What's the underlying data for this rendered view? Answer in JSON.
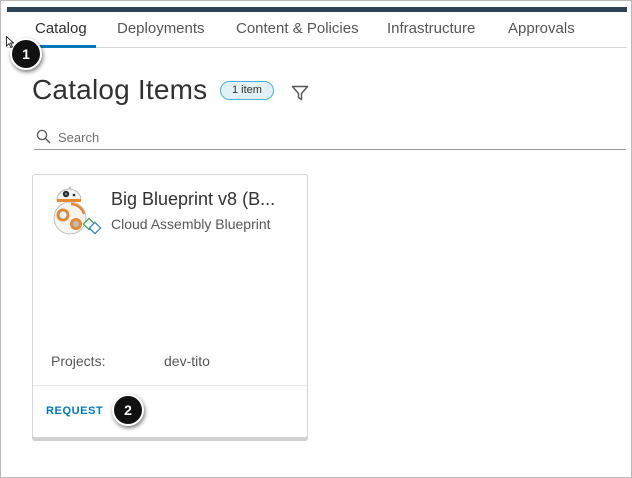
{
  "nav": {
    "tabs": [
      {
        "label": "Catalog",
        "active": true
      },
      {
        "label": "Deployments",
        "active": false
      },
      {
        "label": "Content & Policies",
        "active": false
      },
      {
        "label": "Infrastructure",
        "active": false
      },
      {
        "label": "Approvals",
        "active": false
      }
    ]
  },
  "page": {
    "title": "Catalog Items",
    "count_badge": "1 item",
    "filter_icon": "filter-icon"
  },
  "search": {
    "placeholder": "Search",
    "value": "",
    "icon": "search-icon"
  },
  "catalog_items": [
    {
      "icon": "bb8-robot-icon",
      "title": "Big Blueprint v8 (B...",
      "subtitle": "Cloud Assembly Blueprint",
      "projects_label": "Projects:",
      "projects_value": "dev-tito",
      "request_label": "REQUEST"
    }
  ],
  "markers": [
    "1",
    "2"
  ],
  "colors": {
    "top_bar": "#2f4452",
    "accent": "#0079b8",
    "badge_bg": "#e1f1f6",
    "badge_border": "#49afd9"
  }
}
